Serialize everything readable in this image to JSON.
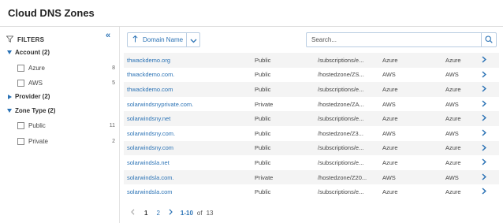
{
  "page": {
    "title": "Cloud DNS Zones"
  },
  "colors": {
    "accent": "#2a72b5",
    "row_stripe": "#f4f4f4",
    "border": "#b9cde2"
  },
  "filters": {
    "label": "FILTERS",
    "icon": "filter-icon",
    "collapse_icon": "double-chevron-left-icon",
    "groups": [
      {
        "label": "Account (2)",
        "expanded": true,
        "options": [
          {
            "label": "Azure",
            "count": "8"
          },
          {
            "label": "AWS",
            "count": "5"
          }
        ]
      },
      {
        "label": "Provider (2)",
        "expanded": false,
        "options": []
      },
      {
        "label": "Zone Type (2)",
        "expanded": true,
        "options": [
          {
            "label": "Public",
            "count": "11"
          },
          {
            "label": "Private",
            "count": "2"
          }
        ]
      }
    ]
  },
  "toolbar": {
    "sort_label": "Domain Name",
    "sort_icon": "arrow-up-icon",
    "dropdown_icon": "chevron-down-icon",
    "search_placeholder": "Search...",
    "search_icon": "search-icon"
  },
  "rows": [
    {
      "name": "thwackdemo.org",
      "visibility": "Public",
      "path": "/subscriptions/e...",
      "provider": "Azure",
      "type": "Azure"
    },
    {
      "name": "thwackdemo.com.",
      "visibility": "Public",
      "path": "/hostedzone/ZS...",
      "provider": "AWS",
      "type": "AWS"
    },
    {
      "name": "thwackdemo.com",
      "visibility": "Public",
      "path": "/subscriptions/e...",
      "provider": "Azure",
      "type": "Azure"
    },
    {
      "name": "solarwindsnyprivate.com.",
      "visibility": "Private",
      "path": "/hostedzone/ZA...",
      "provider": "AWS",
      "type": "AWS"
    },
    {
      "name": "solarwindsny.net",
      "visibility": "Public",
      "path": "/subscriptions/e...",
      "provider": "Azure",
      "type": "Azure"
    },
    {
      "name": "solarwindsny.com.",
      "visibility": "Public",
      "path": "/hostedzone/Z3...",
      "provider": "AWS",
      "type": "AWS"
    },
    {
      "name": "solarwindsny.com",
      "visibility": "Public",
      "path": "/subscriptions/e...",
      "provider": "Azure",
      "type": "Azure"
    },
    {
      "name": "solarwindsla.net",
      "visibility": "Public",
      "path": "/subscriptions/e...",
      "provider": "Azure",
      "type": "Azure"
    },
    {
      "name": "solarwindsla.com.",
      "visibility": "Private",
      "path": "/hostedzone/Z20...",
      "provider": "AWS",
      "type": "AWS"
    },
    {
      "name": "solarwindsla.com",
      "visibility": "Public",
      "path": "/subscriptions/e...",
      "provider": "Azure",
      "type": "Azure"
    }
  ],
  "pagination": {
    "pages": [
      "1",
      "2"
    ],
    "range": "1-10",
    "of": "of",
    "total": "13"
  }
}
